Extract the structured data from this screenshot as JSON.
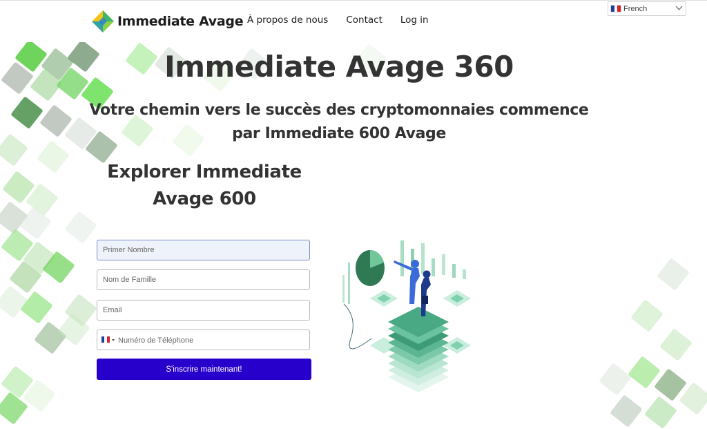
{
  "header": {
    "logo_text": "Immediate Avage",
    "nav": [
      "À propos de nous",
      "Contact",
      "Log in"
    ],
    "language": "French"
  },
  "hero": {
    "title": "Immediate Avage 360",
    "subtitle": "Votre chemin vers le succès des cryptomonnaies commence par Immediate 600 Avage"
  },
  "form": {
    "heading": "Explorer Immediate Avage 600",
    "first_name_placeholder": "Primer Nombre",
    "last_name_placeholder": "Nom de Famille",
    "email_placeholder": "Email",
    "phone_placeholder": "Numéro de Téléphone",
    "submit_label": "S'inscrire maintenant!"
  },
  "colors": {
    "accent": "#2800cc",
    "tile_green": "#5fcf4a",
    "tile_gray": "#8a9a8a",
    "illustration_teal": "#2f8f6a",
    "illustration_blue": "#3a6bd8"
  }
}
